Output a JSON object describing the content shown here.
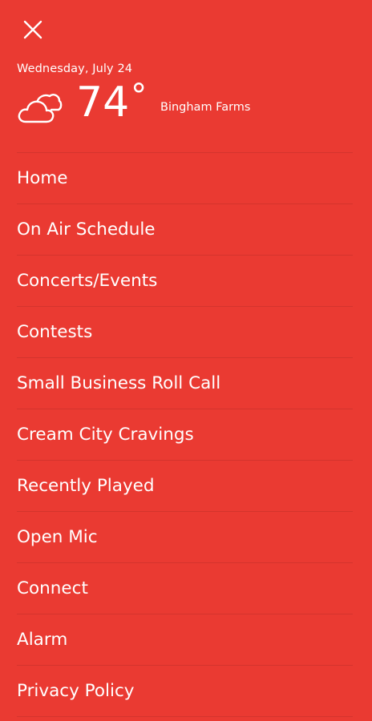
{
  "header": {
    "close_icon": "close-icon",
    "date": "Wednesday, July 24",
    "weather": {
      "icon": "partly-cloudy-icon",
      "temperature": "74",
      "unit": "°",
      "location": "Bingham Farms"
    }
  },
  "menu": {
    "items": [
      {
        "label": "Home"
      },
      {
        "label": "On Air Schedule"
      },
      {
        "label": "Concerts/Events"
      },
      {
        "label": "Contests"
      },
      {
        "label": "Small Business Roll Call"
      },
      {
        "label": "Cream City Cravings"
      },
      {
        "label": "Recently Played"
      },
      {
        "label": "Open Mic"
      },
      {
        "label": "Connect"
      },
      {
        "label": "Alarm"
      },
      {
        "label": "Privacy Policy"
      }
    ]
  },
  "colors": {
    "background": "#EA3A32",
    "text": "#FFFFFF"
  }
}
